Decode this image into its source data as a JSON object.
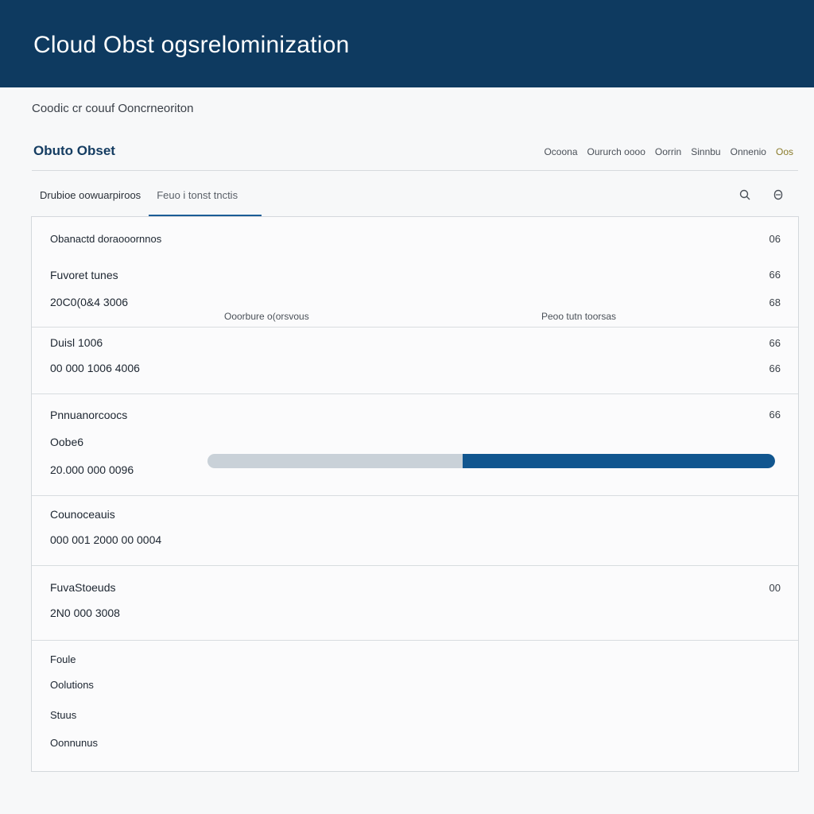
{
  "header": {
    "title": "Cloud Obst  ogsrelominization"
  },
  "breadcrumb": "Coodic cr couuf Ooncrneoriton",
  "brand": "Obuto Obset",
  "nav": {
    "items": [
      "Ocoona",
      "Oururch oooo",
      "Oorrin",
      "Sinnbu",
      "Onnenio"
    ],
    "accent_item": "Oos"
  },
  "tabs": [
    "Drubioe oowuarpiroos",
    "Feuo i tonst tnctis"
  ],
  "toolbar": {
    "search_icon": "search-icon",
    "settings_icon": "gear-icon"
  },
  "sections": {
    "s1": {
      "title": "Obanactd doraooornnos",
      "title_value": "06",
      "label": "Fuvoret tunes",
      "label_value": "66",
      "number": "20C0(0&4 3006",
      "number_value": "68",
      "col_left": "Ooorbure o(orsvous",
      "col_right": "Peoo tutn toorsas"
    },
    "s2": {
      "label": "Duisl 1006",
      "label_value": "66",
      "number": "00 000 1006 4006",
      "number_value": "66"
    },
    "s3": {
      "label": "Pnnuanorcoocs",
      "label_value": "66",
      "sub": "Oobe6",
      "number": "20.000 000 0096",
      "progress_percent": 55
    },
    "s4": {
      "label": "Counoceauis",
      "number": "000 001 2000 00 0004"
    },
    "s5": {
      "label": "FuvaStoeuds",
      "label_value": "00",
      "number": "2N0 000 3008"
    },
    "s6": {
      "items": [
        "Foule",
        "Oolutions",
        "Stuus",
        "Oonnunus"
      ]
    }
  },
  "colors": {
    "header_bg": "#0e3a60",
    "accent": "#11568f",
    "track": "#c9d1d8"
  }
}
